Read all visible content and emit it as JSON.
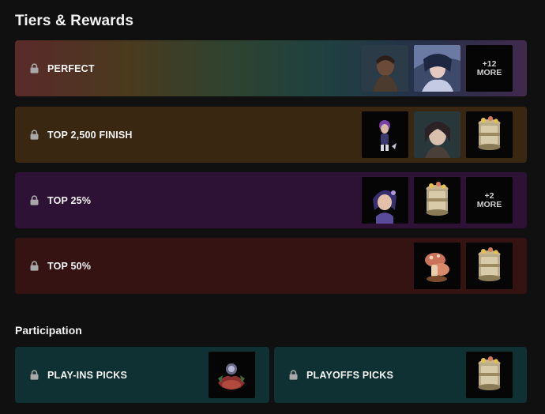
{
  "header": {
    "title": "Tiers & Rewards"
  },
  "tiers": [
    {
      "label": "PERFECT",
      "locked": true,
      "rewards": [
        "champion-portrait-1",
        "champion-portrait-2"
      ],
      "more": "+12",
      "more_word": "MORE"
    },
    {
      "label": "TOP 2,500 FINISH",
      "locked": true,
      "rewards": [
        "chibi-figure",
        "champion-portrait-3",
        "capsule-chest"
      ]
    },
    {
      "label": "TOP 25%",
      "locked": true,
      "rewards": [
        "chibi-portrait",
        "capsule-chest"
      ],
      "more": "+2",
      "more_word": "MORE"
    },
    {
      "label": "TOP 50%",
      "locked": true,
      "rewards": [
        "mushroom-emote",
        "capsule-chest"
      ]
    }
  ],
  "participation": {
    "title": "Participation",
    "items": [
      {
        "label": "PLAY-INS PICKS",
        "locked": true,
        "rewards": [
          "creature-emote"
        ]
      },
      {
        "label": "PLAYOFFS PICKS",
        "locked": true,
        "rewards": [
          "capsule-chest"
        ]
      }
    ]
  },
  "colors": {
    "background": "#101010",
    "top2500": "#3a2712",
    "top25": "#2e1235",
    "top50": "#361313",
    "participation": "#0f3133"
  }
}
